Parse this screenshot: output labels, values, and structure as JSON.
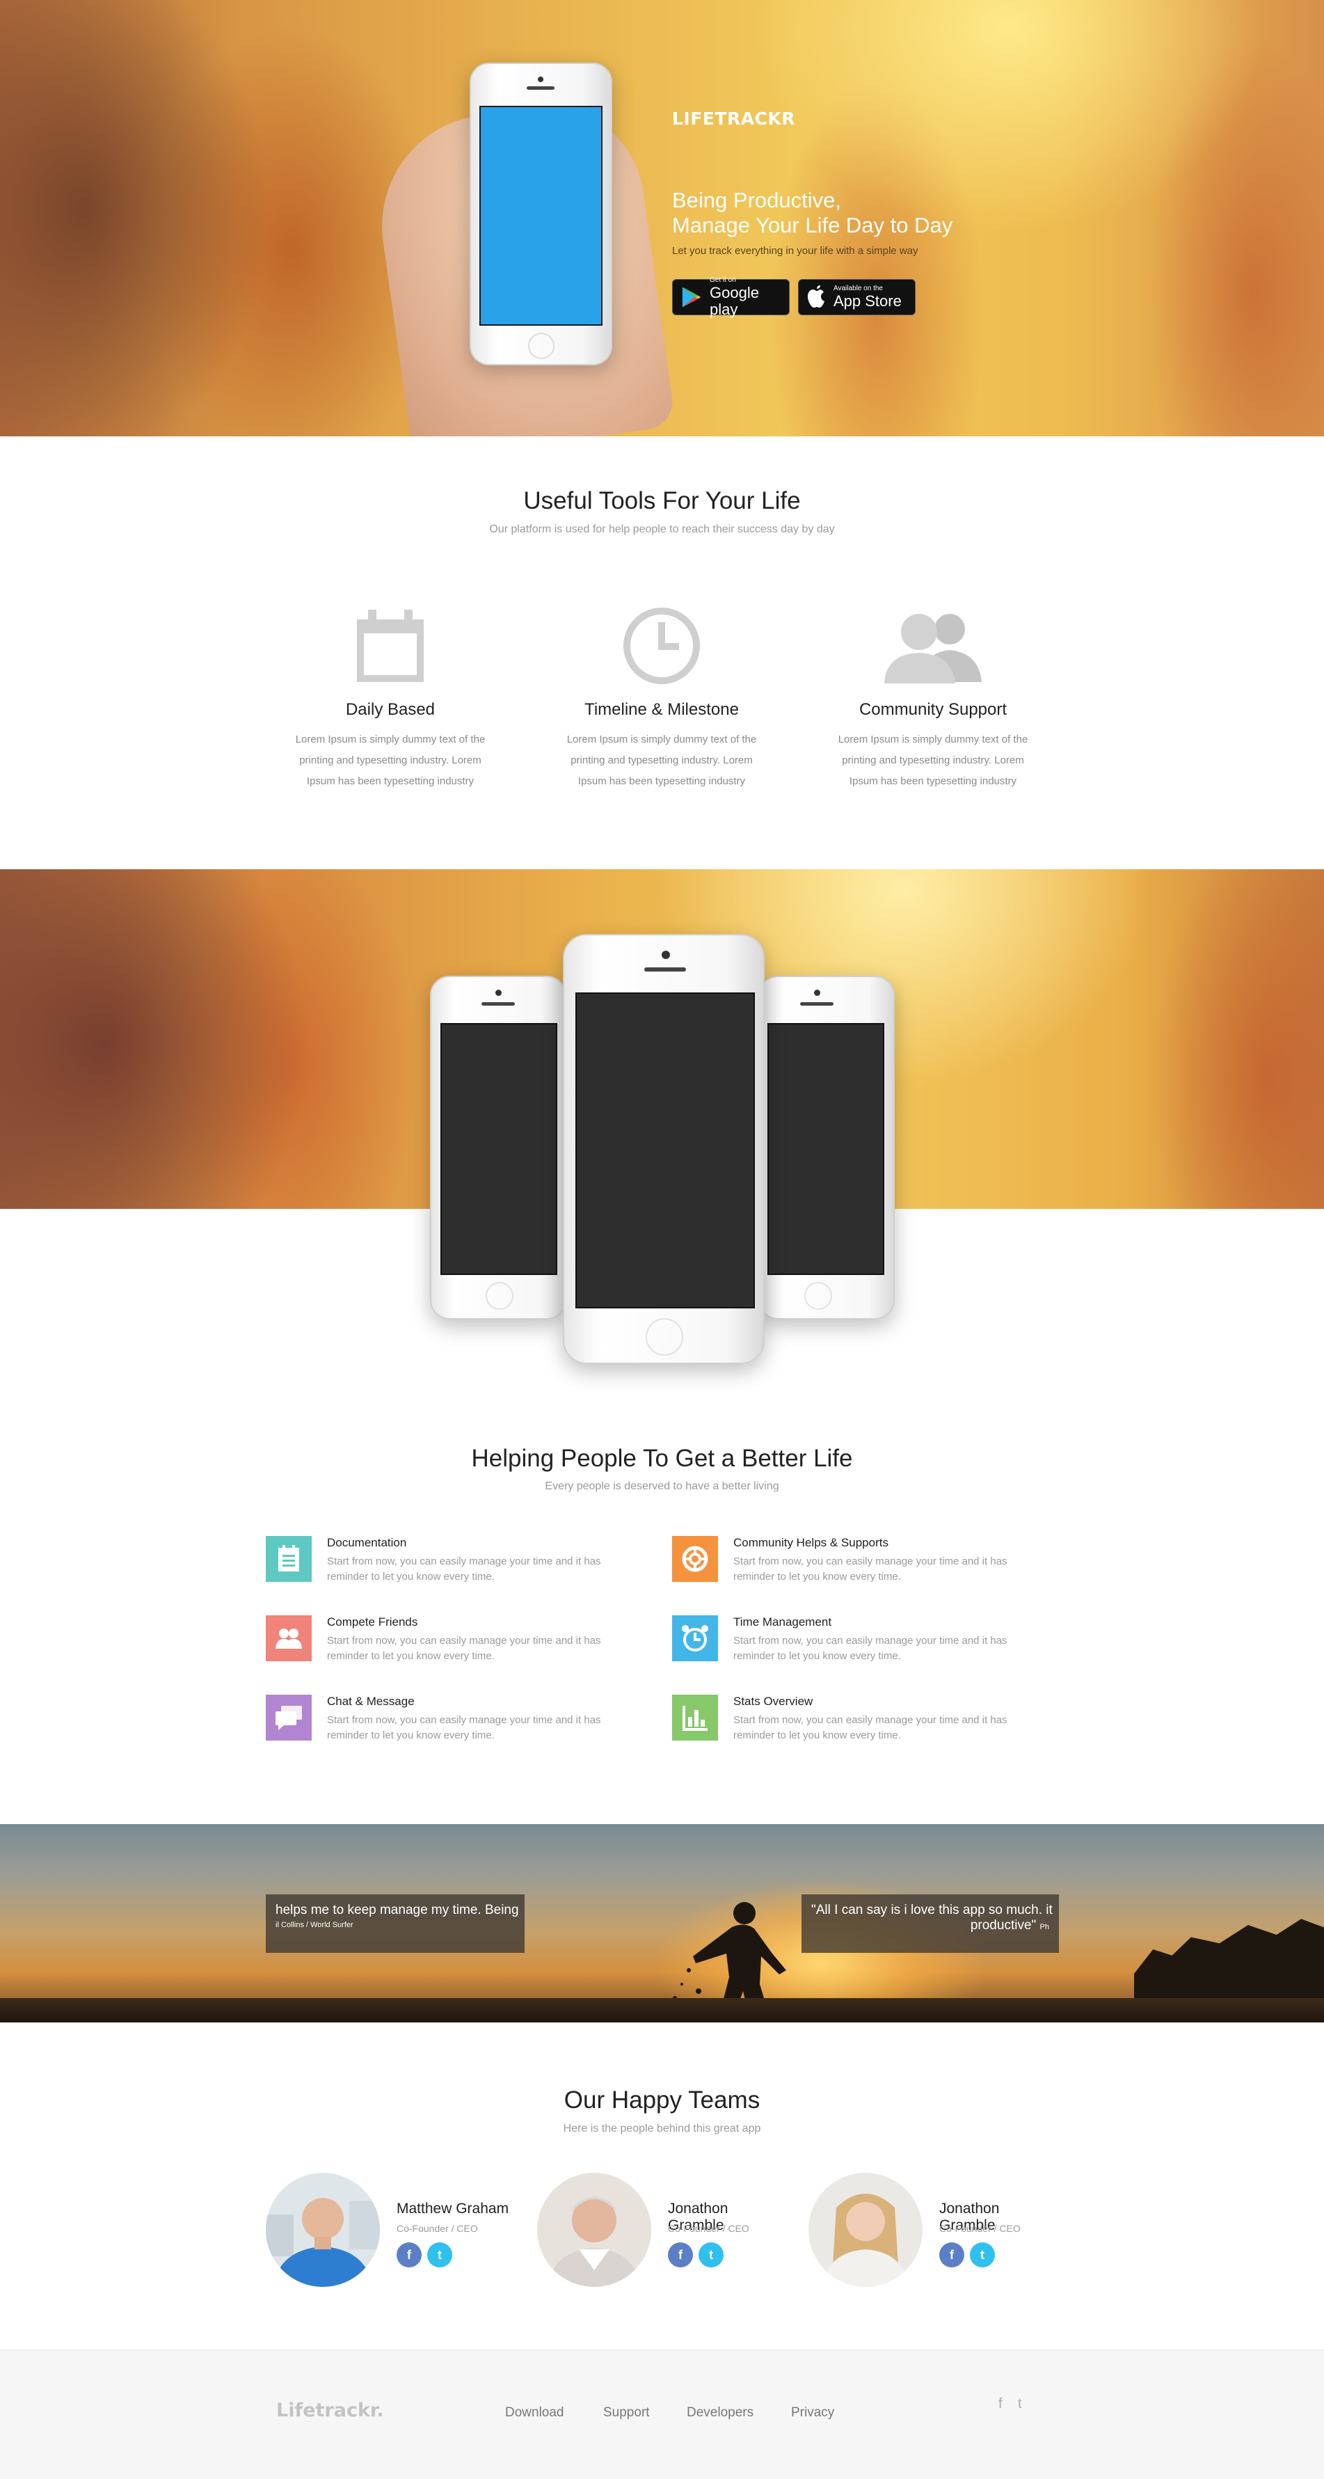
{
  "hero": {
    "brand": "LIFETRACKR",
    "title_line1": "Being Productive,",
    "title_line2": "Manage Your Life Day to Day",
    "subtitle": "Let you track everything in your life with a simple way",
    "google_play": {
      "small": "Get it on",
      "big": "Google play"
    },
    "app_store": {
      "small": "Available on the",
      "big": "App Store"
    }
  },
  "tools": {
    "title": "Useful Tools For Your Life",
    "subtitle": "Our platform is used for help people to reach their success day by day",
    "items": [
      {
        "icon": "calendar-icon",
        "title": "Daily Based",
        "desc": "Lorem Ipsum is simply dummy text of the printing and typesetting industry. Lorem Ipsum has been typesetting industry"
      },
      {
        "icon": "clock-icon",
        "title": "Timeline & Milestone",
        "desc": "Lorem Ipsum is simply dummy text of the printing and typesetting industry. Lorem Ipsum has been typesetting industry"
      },
      {
        "icon": "users-icon",
        "title": "Community Support",
        "desc": "Lorem Ipsum is simply dummy text of the printing and typesetting industry. Lorem Ipsum has been typesetting industry"
      }
    ]
  },
  "features": {
    "title": "Helping People To Get a Better Life",
    "subtitle": "Every people is deserved to have a better living",
    "items": [
      {
        "icon": "document-icon",
        "color": "#5ec8c2",
        "title": "Documentation",
        "desc": "Start from now, you can easily manage your time and it has reminder to let you know every time."
      },
      {
        "icon": "lifebuoy-icon",
        "color": "#f5923e",
        "title": "Community Helps & Supports",
        "desc": "Start from now, you can easily manage your time and it has reminder to let you know every time."
      },
      {
        "icon": "friends-icon",
        "color": "#f0837a",
        "title": "Compete Friends",
        "desc": "Start from now, you can easily manage your time and it has reminder to let you know every time."
      },
      {
        "icon": "alarm-clock-icon",
        "color": "#42b6e8",
        "title": "Time Management",
        "desc": "Start from now, you can easily manage your time and it has reminder to let you know every time."
      },
      {
        "icon": "chat-icon",
        "color": "#b285d3",
        "title": "Chat & Message",
        "desc": "Start from now, you can easily manage your time and it has reminder to let you know every time."
      },
      {
        "icon": "bar-chart-icon",
        "color": "#86c86a",
        "title": "Stats Overview",
        "desc": "Start from now, you can easily manage your time and it has reminder to let you know every time."
      }
    ]
  },
  "testimonials": {
    "left": {
      "quote": "helps me to keep manage my time. Being",
      "author": "il Collins / World Surfer"
    },
    "right": {
      "quote": "\"All I can say is i love this app so much. it",
      "quote2": "productive\"",
      "author": "Ph"
    }
  },
  "team": {
    "title": "Our Happy Teams",
    "subtitle": "Here is the people behind this great app",
    "members": [
      {
        "name": "Matthew Graham",
        "role": "Co-Founder / CEO"
      },
      {
        "name": "Jonathon Gramble",
        "role": "Co-Founder / CEO"
      },
      {
        "name": "Jonathon Gramble",
        "role": "Co-Founder / CEO"
      }
    ],
    "fb_glyph": "f",
    "tw_glyph": "t"
  },
  "footer": {
    "logo": "Lifetrackr.",
    "links": [
      "Download",
      "Support",
      "Developers",
      "Privacy"
    ],
    "fb_glyph": "f",
    "tw_glyph": "t"
  }
}
